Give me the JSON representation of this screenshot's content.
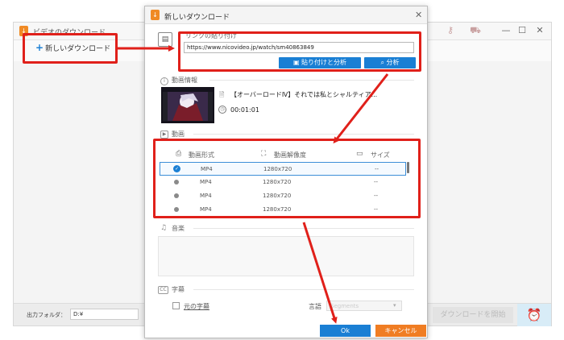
{
  "bg_window": {
    "title": "ビデオのダウンロード",
    "new_download_label": "新しいダウンロード",
    "output_folder_label": "出力フォルダ：",
    "output_folder_value": "D:¥",
    "download_all_label": "ダウンロードを開始",
    "controls": {
      "minimize": "—",
      "maximize": "☐",
      "close": "✕"
    }
  },
  "dialog": {
    "title": "新しいダウンロード",
    "link_section": {
      "label": "リンクの貼り付け",
      "url_value": "https://www.nicovideo.jp/watch/sm40863849",
      "paste_analyze_label": "貼り付けと分析",
      "analyze_label": "分析"
    },
    "info_section": {
      "label": "動画情報",
      "video_title": "【オーバーロードⅣ】それでは私とシャルティア...",
      "duration": "00:01:01"
    },
    "video_section": {
      "label": "動画",
      "columns": [
        "動画形式",
        "動画解像度",
        "サイズ"
      ],
      "rows": [
        {
          "format": "MP4",
          "resolution": "1280x720",
          "size": "--",
          "selected": true
        },
        {
          "format": "MP4",
          "resolution": "1280x720",
          "size": "--",
          "selected": false
        },
        {
          "format": "MP4",
          "resolution": "1280x720",
          "size": "--",
          "selected": false
        },
        {
          "format": "MP4",
          "resolution": "1280x720",
          "size": "--",
          "selected": false
        }
      ]
    },
    "audio_section": {
      "label": "音楽"
    },
    "subtitle_section": {
      "label": "字幕",
      "original_subtitle_label": "元の字幕",
      "language_label": "言語",
      "language_placeholder": "Segments"
    },
    "ok_label": "Ok",
    "cancel_label": "キャンセル"
  },
  "colors": {
    "accent_blue": "#1a7fd4",
    "cancel_orange": "#f07d23",
    "highlight_red": "#e0201a"
  },
  "icons": [
    "app-icon",
    "plus-icon",
    "clipboard-icon",
    "search-icon",
    "info-icon",
    "document-icon",
    "clock-icon",
    "film-icon",
    "format-icon",
    "resolution-icon",
    "folder-icon",
    "check-icon",
    "music-icon",
    "cc-icon",
    "alarm-icon"
  ]
}
